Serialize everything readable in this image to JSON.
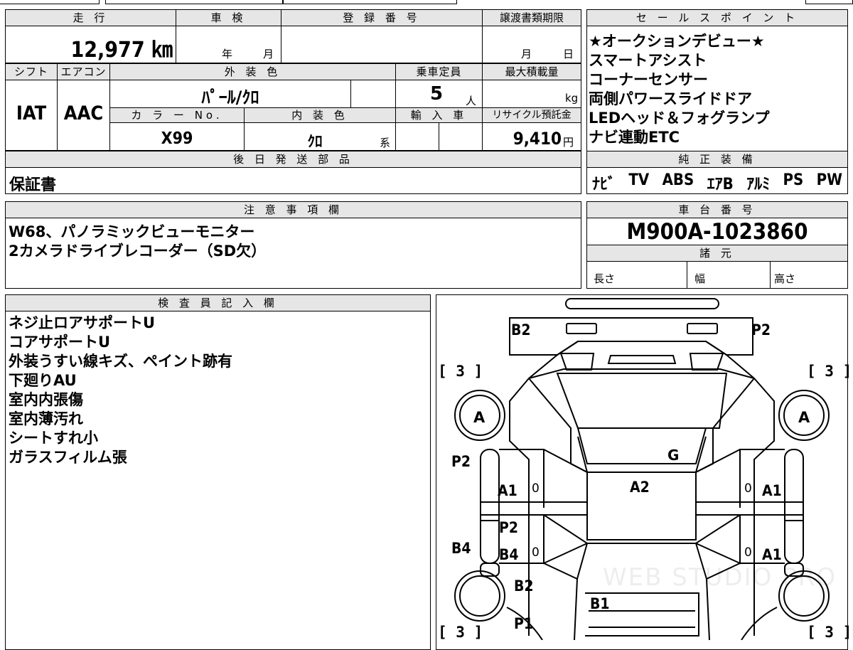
{
  "vehicle": {
    "mileage_header": "走 行",
    "mileage": "12,977 ㎞",
    "inspection_header": "車 検",
    "inspection_year": "年",
    "inspection_month": "月",
    "registration_header": "登 録 番 号",
    "deadline_header": "譲渡書類期限",
    "deadline_month": "月",
    "deadline_day": "日",
    "shift_header": "シフト",
    "shift": "IAT",
    "ac_header": "エアコン",
    "ac": "AAC",
    "exterior_header": "外 装 色",
    "exterior_color": "ﾊﾟｰﾙ/ｸﾛ",
    "capacity_header": "乗車定員",
    "capacity": "5",
    "capacity_unit": "人",
    "max_load_header": "最大積載量",
    "max_load_unit": "kg",
    "color_no_header": "カ ラ ー No.",
    "color_no": "X99",
    "interior_header": "内 装 色",
    "interior_color": "ｸﾛ",
    "interior_suffix": "系",
    "import_header": "輸 入 車",
    "recycle_header": "リサイクル預託金",
    "recycle_fee": "9,410",
    "recycle_unit": "円",
    "later_parts_header": "後 日 発 送 部 品",
    "later_parts": "保証書"
  },
  "sales_points": {
    "header": "セ ー ル ス ポ イ ン ト",
    "items": [
      "★オークションデビュー★",
      "スマートアシスト",
      "コーナーセンサー",
      "両側パワースライドドア",
      "LEDヘッド＆フォグランプ",
      "ナビ連動ETC"
    ]
  },
  "equipment": {
    "header": "純 正 装 備",
    "items": [
      "ﾅﾋﾞ",
      "TV",
      "ABS",
      "ｴｱB",
      "ｱﾙﾐ",
      "PS",
      "PW"
    ]
  },
  "notes": {
    "header": "注 意 事 項 欄",
    "lines": [
      "W68、パノラミックビューモニター",
      "2カメラドライブレコーダー（SD欠）"
    ]
  },
  "chassis": {
    "header": "車 台 番 号",
    "number": "M900A-1023860",
    "specs_header": "諸 元",
    "length_label": "長さ",
    "width_label": "幅",
    "height_label": "高さ"
  },
  "inspector": {
    "header": "検 査 員 記 入 欄",
    "lines": [
      "ネジ止ロアサポートU",
      "コアサポートU",
      "外装うすい線キズ、ペイント跡有",
      "下廻りAU",
      "室内内張傷",
      "室内薄汚れ",
      "シートすれ小",
      "ガラスフィルム張"
    ]
  },
  "diagram": {
    "labels": {
      "b2_top": "B2",
      "p2_top": "P2",
      "bracket_tl": "[ 3 ]",
      "bracket_tr": "[ 3 ]",
      "bracket_bl": "[ 3 ]",
      "bracket_br": "[ 3 ]",
      "tire_fl": "A",
      "tire_fr": "A",
      "g_windshield": "G",
      "p2_left": "P2",
      "a1_left": "A1",
      "zero_1": "0",
      "a2_roof": "A2",
      "zero_2": "0",
      "a1_right": "A1",
      "p2_mid": "P2",
      "b4_left": "B4",
      "b4_mid": "B4",
      "zero_3": "0",
      "zero_4": "0",
      "a1_right2": "A1",
      "b2_bottom": "B2",
      "b1": "B1",
      "p1": "P1"
    },
    "watermark": "WEB STUDIO PRO"
  }
}
